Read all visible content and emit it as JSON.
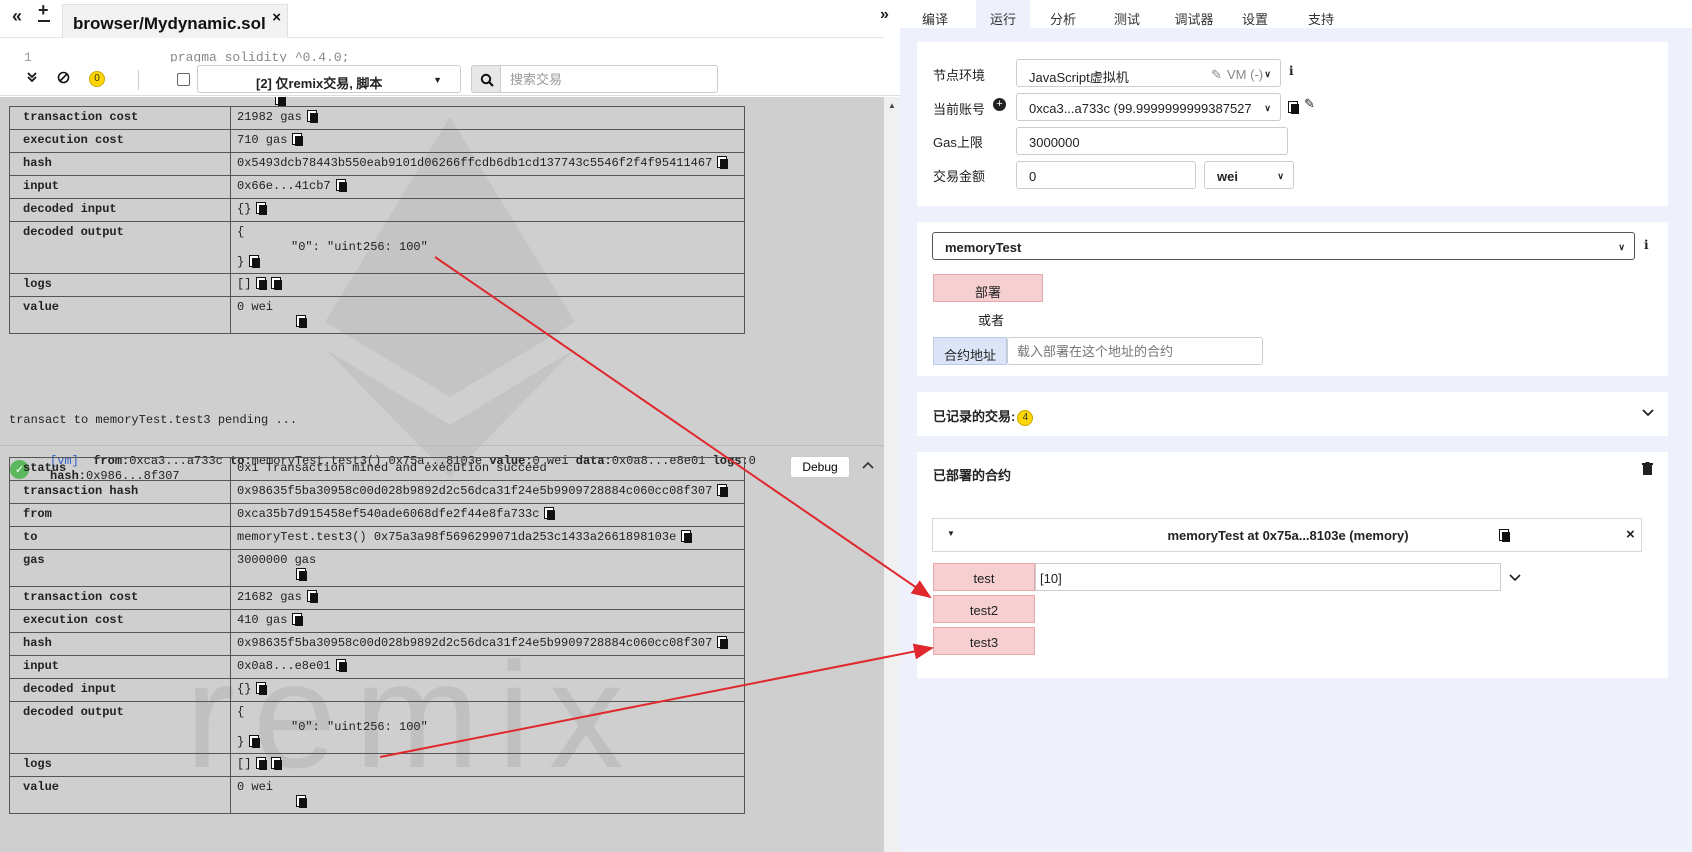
{
  "editor": {
    "collapse_left": "«",
    "new_file": "+",
    "file_tab": "browser/Mydynamic.sol",
    "close": "×",
    "collapse_right": "»",
    "line_number": "1",
    "code_snippet": "pragma solidity ^0.4.0;"
  },
  "terminal_bar": {
    "pending_count": "0",
    "filter_label": "[2] 仅remix交易, 脚本",
    "search_placeholder": "搜索交易"
  },
  "tx1": {
    "rows": [
      {
        "key": "transaction cost",
        "value": "21982 gas"
      },
      {
        "key": "execution cost",
        "value": "710 gas"
      },
      {
        "key": "hash",
        "value": "0x5493dcb78443b550eab9101d06266ffcdb6db1cd137743c5546f2f4f95411467"
      },
      {
        "key": "input",
        "value": "0x66e...41cb7"
      },
      {
        "key": "decoded input",
        "value": "{}"
      },
      {
        "key": "decoded output",
        "open": "{",
        "line": "\"0\": \"uint256: 100\"",
        "close": "}"
      },
      {
        "key": "logs",
        "value": "[]"
      },
      {
        "key": "value",
        "value": "0 wei"
      }
    ]
  },
  "pending_text": "transact to memoryTest.test3 pending ...",
  "tx2": {
    "vm": "[vm]",
    "from_label": "from:",
    "from": "0xca3...a733c",
    "to_label": "to:",
    "to": "memoryTest.test3() 0x75a...8103e",
    "value_label": "value:",
    "value": "0 wei",
    "data_label": "data:",
    "data": "0x0a8...e8e01",
    "logs_label": "logs:",
    "logs": "0",
    "hash_label": "hash:",
    "hash": "0x986...8f307",
    "debug": "Debug",
    "rows": [
      {
        "key": "status",
        "value": "0x1 Transaction mined and execution succeed"
      },
      {
        "key": "transaction hash",
        "value": "0x98635f5ba30958c00d028b9892d2c56dca31f24e5b9909728884c060cc08f307"
      },
      {
        "key": "from",
        "value": "0xca35b7d915458ef540ade6068dfe2f44e8fa733c"
      },
      {
        "key": "to",
        "value": "memoryTest.test3() 0x75a3a98f5696299071da253c1433a2661898103e"
      },
      {
        "key": "gas",
        "value": "3000000 gas"
      },
      {
        "key": "transaction cost",
        "value": "21682 gas"
      },
      {
        "key": "execution cost",
        "value": "410 gas"
      },
      {
        "key": "hash",
        "value": "0x98635f5ba30958c00d028b9892d2c56dca31f24e5b9909728884c060cc08f307"
      },
      {
        "key": "input",
        "value": "0x0a8...e8e01"
      },
      {
        "key": "decoded input",
        "value": "{}"
      },
      {
        "key": "decoded output",
        "open": "{",
        "line": "\"0\": \"uint256: 100\"",
        "close": "}"
      },
      {
        "key": "logs",
        "value": "[]"
      },
      {
        "key": "value",
        "value": "0 wei"
      }
    ]
  },
  "watermark": "remix",
  "right_tabs": [
    "编译",
    "运行",
    "分析",
    "测试",
    "调试器",
    "设置",
    "支持"
  ],
  "env": {
    "env_label": "节点环境",
    "env_value": "JavaScript虚拟机",
    "env_hint": "VM (-)",
    "account_label": "当前账号",
    "account_value": "0xca3...a733c (99.9999999999387527",
    "gas_label": "Gas上限",
    "gas_value": "3000000",
    "value_label": "交易金额",
    "value_value": "0",
    "unit": "wei",
    "info": "i"
  },
  "deploy": {
    "contract": "memoryTest",
    "deploy_btn": "部署",
    "or": "或者",
    "at_address_btn": "合约地址",
    "at_address_placeholder": "载入部署在这个地址的合约"
  },
  "recorded": {
    "title": "已记录的交易:",
    "count": "4"
  },
  "deployed": {
    "title": "已部署的合约",
    "instance": "memoryTest at 0x75a...8103e (memory)",
    "test_btn": "test",
    "test_value": "[10]",
    "test2_btn": "test2",
    "test3_btn": "test3"
  },
  "colors": {
    "arrow": "#e0282e",
    "pink_button": "#f6cfd0",
    "panel_bg": "#eef0fb"
  }
}
